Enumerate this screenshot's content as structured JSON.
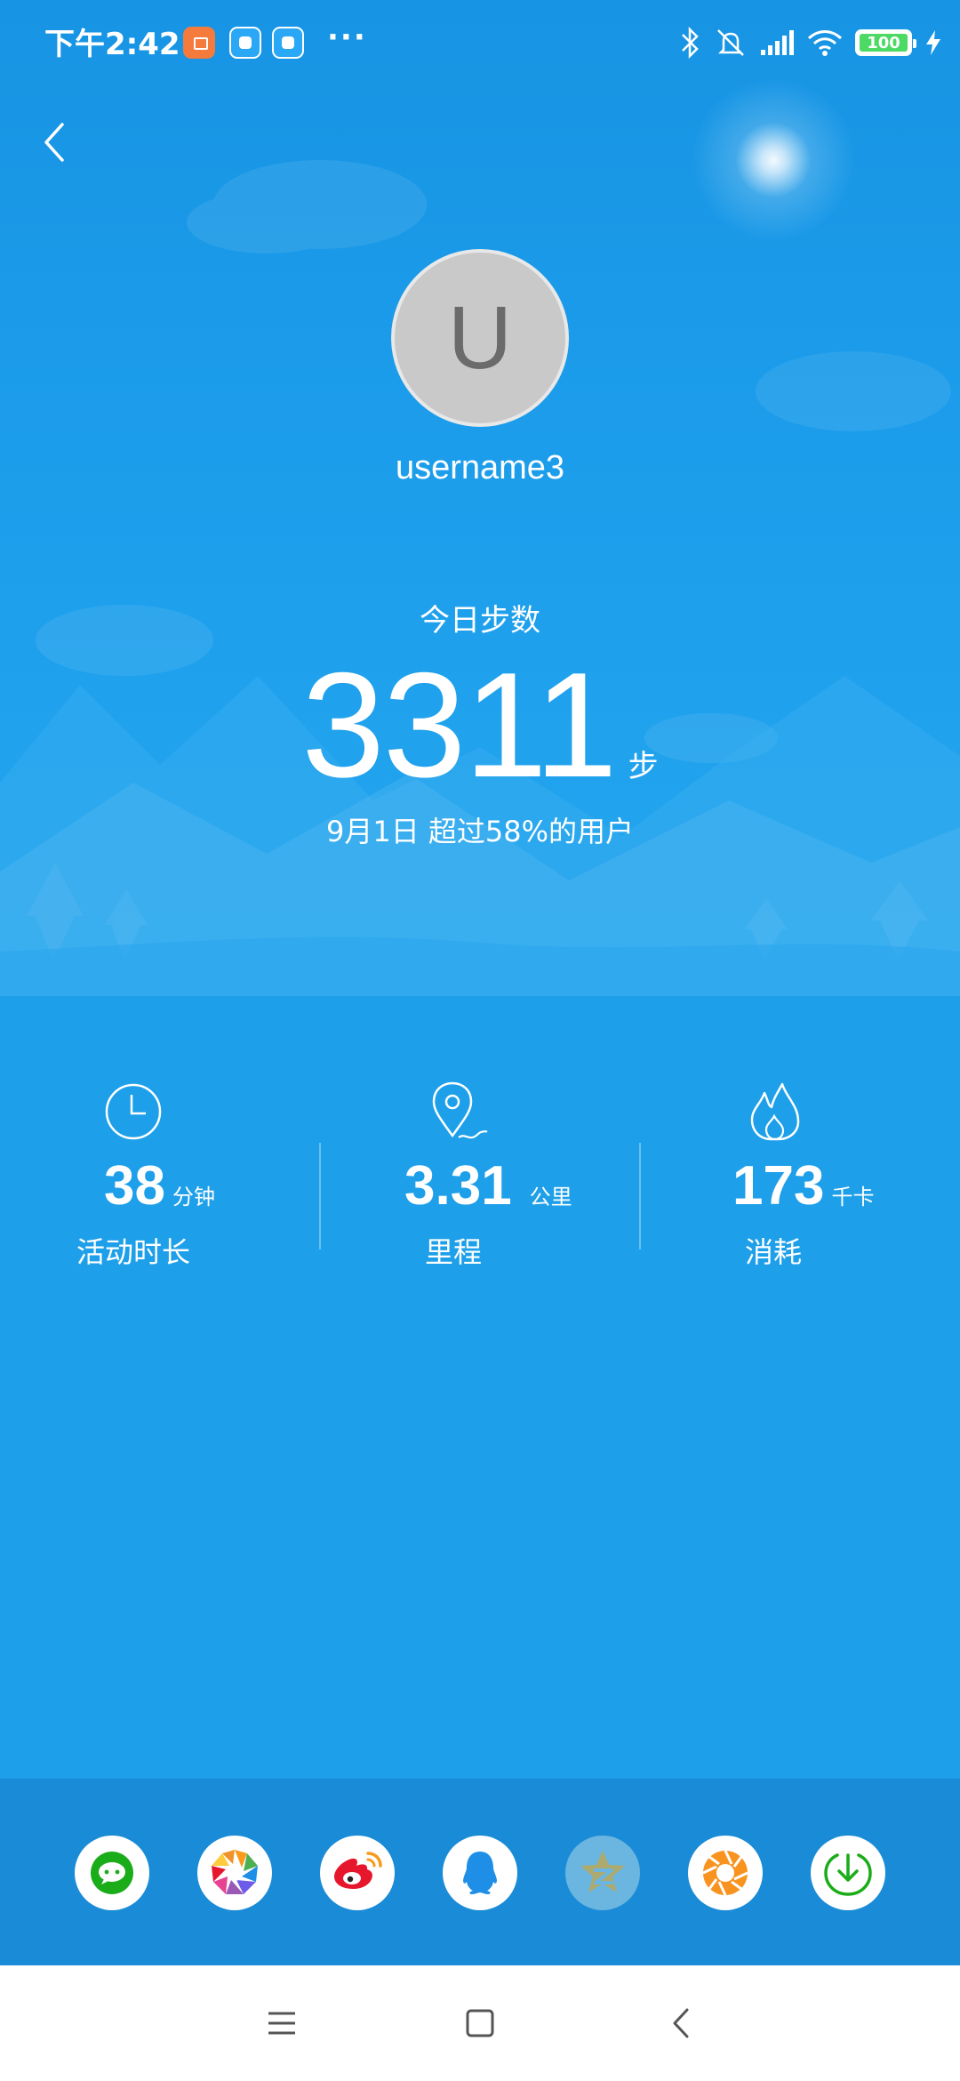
{
  "status_bar": {
    "time": "下午2:42",
    "battery": "100",
    "icons": [
      "bluetooth-icon",
      "silent-icon",
      "signal-icon",
      "wifi-icon",
      "battery-icon",
      "charging-icon"
    ],
    "notification_icons": [
      "mi-store-icon",
      "app-icon",
      "app-icon"
    ],
    "more": "···"
  },
  "profile": {
    "avatar_letter": "U",
    "username": "username3"
  },
  "steps": {
    "label": "今日步数",
    "value": "3311",
    "unit": "步",
    "subtitle": "9月1日 超过58%的用户"
  },
  "stats": [
    {
      "icon": "clock-icon",
      "value": "38",
      "unit": "分钟",
      "label": "活动时长"
    },
    {
      "icon": "location-pin-icon",
      "value": "3.31",
      "unit": "公里",
      "label": "里程"
    },
    {
      "icon": "flame-icon",
      "value": "173",
      "unit": "千卡",
      "label": "消耗"
    }
  ],
  "share_targets": [
    "wechat-icon",
    "moments-icon",
    "weibo-icon",
    "qq-icon",
    "qzone-icon",
    "camera-icon",
    "download-icon"
  ],
  "nav": [
    "menu-icon",
    "home-icon",
    "back-icon"
  ],
  "colors": {
    "background": "#1d9fe9",
    "share_bar": "#1a8bd6",
    "wechat": "#1aad19",
    "weibo": "#e6162d",
    "qq": "#1e8ee6",
    "accent_orange": "#f89b1d"
  }
}
